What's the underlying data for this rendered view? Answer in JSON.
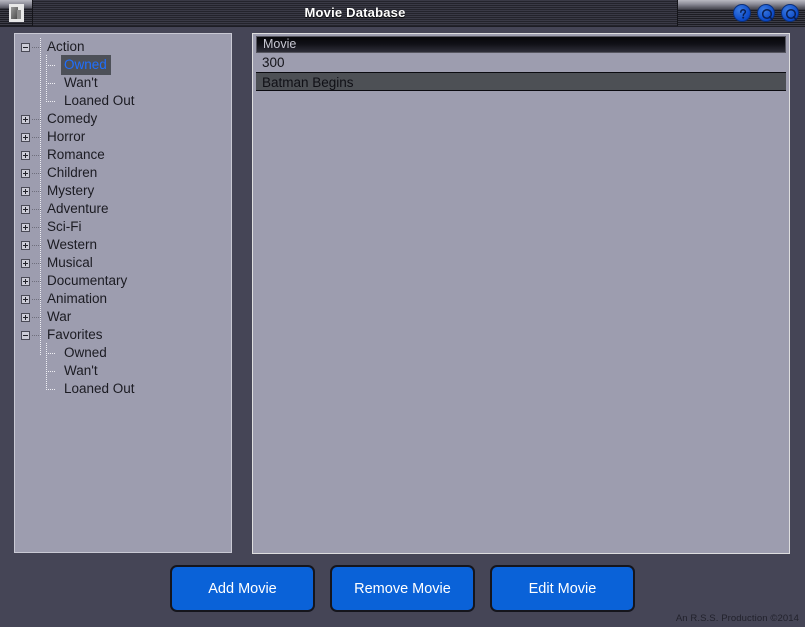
{
  "window": {
    "title": "Movie Database",
    "app_icon": "film-icon",
    "controls": [
      {
        "name": "help-button",
        "icon": "question-circle-icon"
      },
      {
        "name": "minimize-button",
        "icon": "minimize-circle-icon"
      },
      {
        "name": "close-button",
        "icon": "close-circle-icon"
      }
    ]
  },
  "tree": {
    "nodes": [
      {
        "label": "Action",
        "depth": 0,
        "state": "expanded",
        "selected": false
      },
      {
        "label": "Owned",
        "depth": 1,
        "state": "leaf",
        "selected": true
      },
      {
        "label": "Wan't",
        "depth": 1,
        "state": "leaf",
        "selected": false
      },
      {
        "label": "Loaned Out",
        "depth": 1,
        "state": "leaf-last",
        "selected": false
      },
      {
        "label": "Comedy",
        "depth": 0,
        "state": "collapsed",
        "selected": false
      },
      {
        "label": "Horror",
        "depth": 0,
        "state": "collapsed",
        "selected": false
      },
      {
        "label": "Romance",
        "depth": 0,
        "state": "collapsed",
        "selected": false
      },
      {
        "label": "Children",
        "depth": 0,
        "state": "collapsed",
        "selected": false
      },
      {
        "label": "Mystery",
        "depth": 0,
        "state": "collapsed",
        "selected": false
      },
      {
        "label": "Adventure",
        "depth": 0,
        "state": "collapsed",
        "selected": false
      },
      {
        "label": "Sci-Fi",
        "depth": 0,
        "state": "collapsed",
        "selected": false
      },
      {
        "label": "Western",
        "depth": 0,
        "state": "collapsed",
        "selected": false
      },
      {
        "label": "Musical",
        "depth": 0,
        "state": "collapsed",
        "selected": false
      },
      {
        "label": "Documentary",
        "depth": 0,
        "state": "collapsed",
        "selected": false
      },
      {
        "label": "Animation",
        "depth": 0,
        "state": "collapsed",
        "selected": false
      },
      {
        "label": "War",
        "depth": 0,
        "state": "collapsed",
        "selected": false
      },
      {
        "label": "Favorites",
        "depth": 0,
        "state": "expanded",
        "selected": false
      },
      {
        "label": "Owned",
        "depth": 1,
        "state": "leaf",
        "selected": false
      },
      {
        "label": "Wan't",
        "depth": 1,
        "state": "leaf",
        "selected": false
      },
      {
        "label": "Loaned Out",
        "depth": 1,
        "state": "leaf-last",
        "selected": false
      }
    ]
  },
  "list": {
    "column_header": "Movie",
    "rows": [
      {
        "title": "300",
        "selected": false
      },
      {
        "title": "Batman Begins",
        "selected": true
      }
    ]
  },
  "buttons": [
    {
      "name": "add-movie-button",
      "label": "Add Movie"
    },
    {
      "name": "remove-movie-button",
      "label": "Remove Movie"
    },
    {
      "name": "edit-movie-button",
      "label": "Edit Movie"
    }
  ],
  "footer": {
    "credit": "An R.S.S. Production ©2014"
  },
  "colors": {
    "page_background": "#454556",
    "panel_background": "#9d9daf",
    "button_blue": "#0a62d8",
    "selection_text_blue": "#1f6fff",
    "selected_row": "#4d5055",
    "titlebar_dark": "#24242c"
  }
}
